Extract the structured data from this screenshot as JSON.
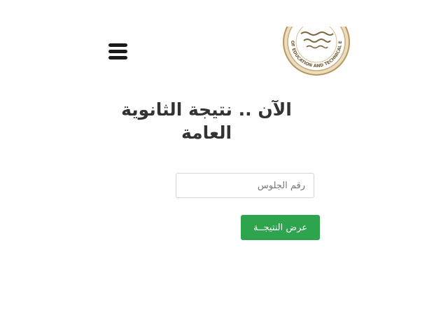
{
  "header": {
    "menu_icon": "hamburger-menu-icon",
    "logo_icon": "ministry-seal-icon",
    "logo_text": "MINISTRY OF EDUCATION AND TECHNICAL EDUCATION"
  },
  "main": {
    "headline": "الآن .. نتيجة الثانوية العامة",
    "seat_number_placeholder": "رقم الجلوس",
    "seat_number_value": "",
    "submit_label": "عرض النتيجــة"
  },
  "colors": {
    "button_bg": "#2ea44f",
    "headline_text": "#333333",
    "seal_gold": "#b8975a"
  }
}
